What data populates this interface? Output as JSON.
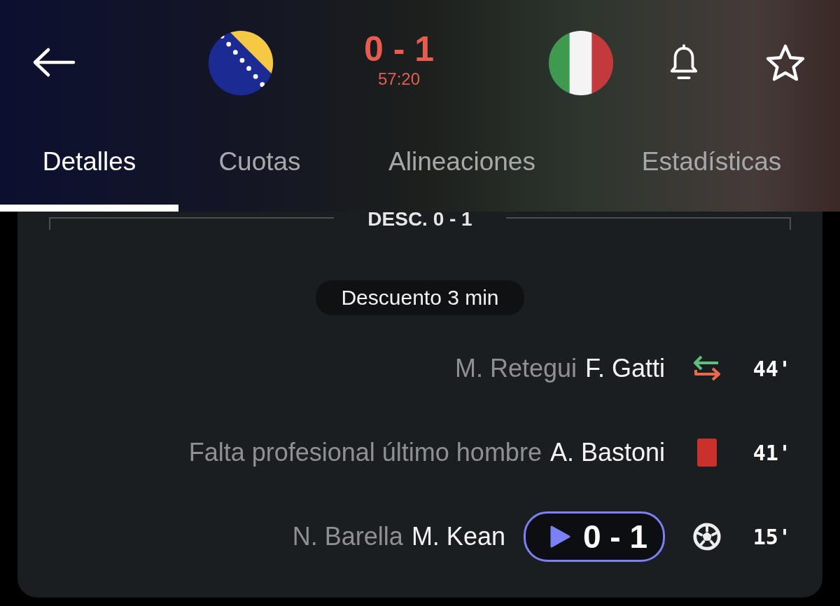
{
  "match": {
    "score": "0 - 1",
    "clock": "57:20"
  },
  "tabs": [
    {
      "label": "Detalles",
      "selected": true
    },
    {
      "label": "Cuotas",
      "selected": false
    },
    {
      "label": "Alineaciones",
      "selected": false
    },
    {
      "label": "Estadísticas",
      "selected": false
    }
  ],
  "section": {
    "title": "DESC. 0 - 1",
    "added_time": "Descuento 3 min"
  },
  "events": [
    {
      "kind": "substitution",
      "detail": "M. Retegui",
      "player": "F. Gatti",
      "minute": "44'"
    },
    {
      "kind": "red_card",
      "detail": "Falta profesional último hombre",
      "player": "A. Bastoni",
      "minute": "41'"
    },
    {
      "kind": "goal",
      "detail": "N. Barella",
      "player": "M. Kean",
      "score": "0 - 1",
      "minute": "15'"
    }
  ]
}
